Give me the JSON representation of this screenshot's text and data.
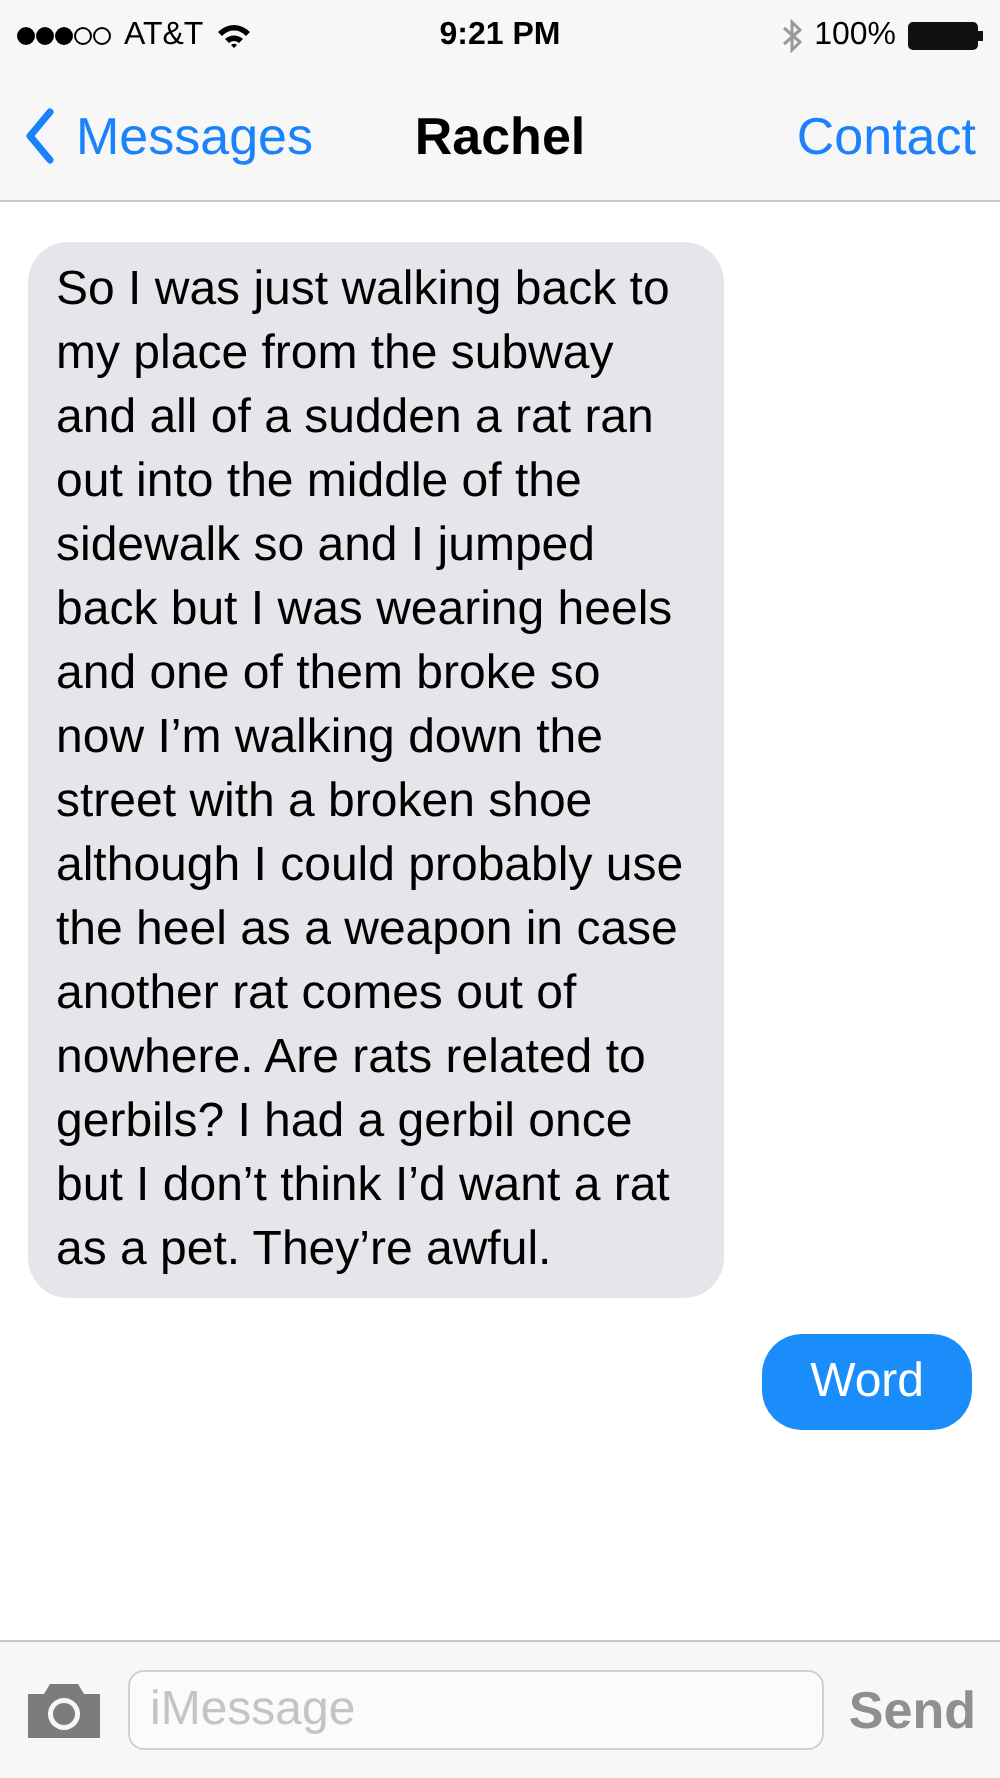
{
  "status_bar": {
    "carrier": "AT&T",
    "time": "9:21 PM",
    "battery": "100%"
  },
  "nav": {
    "back": "Messages",
    "title": "Rachel",
    "action": "Contact"
  },
  "messages": [
    {
      "kind": "incoming",
      "text": "So I was just walking back to my place from the subway and all of a sudden a rat ran out into the middle of the sidewalk so and I jumped back but I was wearing heels and one of them broke so now I’m walking down the street with a broken shoe although I could probably use the heel as a weapon in case another rat comes out of nowhere. Are rats related to gerbils? I had a gerbil once but I don’t think I’d want a rat as a pet. They’re awful."
    },
    {
      "kind": "outgoing",
      "text": "Word"
    }
  ],
  "input": {
    "placeholder": "iMessage",
    "send": "Send",
    "send_disabled": true
  }
}
